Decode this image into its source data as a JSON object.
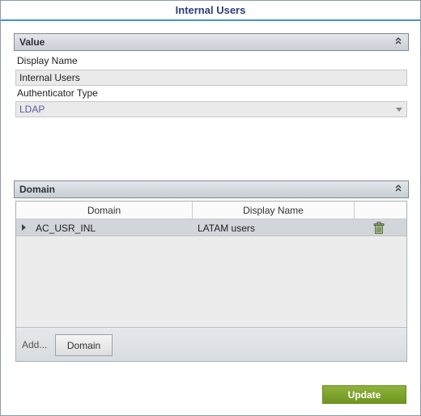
{
  "window": {
    "title": "Internal Users"
  },
  "value_section": {
    "header": "Value",
    "display_name_label": "Display Name",
    "display_name_value": "Internal Users",
    "authenticator_type_label": "Authenticator Type",
    "authenticator_type_value": "LDAP"
  },
  "domain_section": {
    "header": "Domain",
    "columns": [
      "Domain",
      "Display Name",
      ""
    ],
    "rows": [
      {
        "domain": "AC_USR_INL",
        "display_name": "LATAM users"
      }
    ],
    "footer": {
      "add_label": "Add...",
      "domain_button": "Domain"
    }
  },
  "actions": {
    "update_label": "Update"
  },
  "icons": {
    "collapse": "double-chevron-up-icon",
    "dropdown": "dropdown-arrow-icon",
    "expander": "row-expander-icon",
    "delete": "trash-icon"
  },
  "colors": {
    "accent": "#4a90c8",
    "title": "#2d3e7a",
    "update_button": "#7ba12c"
  }
}
